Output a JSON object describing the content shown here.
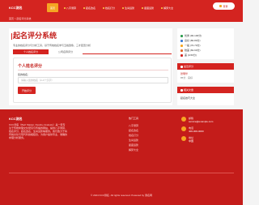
{
  "header": {
    "logo": "KCC测名",
    "nav": [
      {
        "label": "首页",
        "active": true
      },
      {
        "label": "八字测算",
        "active": false
      },
      {
        "label": "起名改名",
        "active": false
      },
      {
        "label": "姓名打分",
        "active": false
      },
      {
        "label": "生肖运势",
        "active": false
      },
      {
        "label": "星座运势",
        "active": false
      },
      {
        "label": "解梦大全",
        "active": false
      }
    ],
    "login_label": "登录",
    "breadcrumb": "首页 > 起名评分系统"
  },
  "main": {
    "title": "起名评分系统",
    "description": "专业的姓名评分与分析工具，基于传统姓名学与五格剖象，三才配置分析",
    "tabs": [
      "个人姓名评分",
      "公司名称评分"
    ],
    "form": {
      "title": "个人姓名评分",
      "label": "您的姓名：",
      "placeholder": "请输入您的姓名（2-4个汉字）",
      "submit_label": "开始评分"
    }
  },
  "sidebar": {
    "legend": [
      {
        "label": "优秀 (90-100分)",
        "color": "#2e9e4f"
      },
      {
        "label": "良好 (80-89分)",
        "color": "#3a7bd5"
      },
      {
        "label": "一般 (70-79分)",
        "color": "#f5a623"
      },
      {
        "label": "较差 (60-69分)",
        "color": "#e06c2c"
      },
      {
        "label": "差 (0-59分)",
        "color": "#d42420"
      }
    ],
    "recent": {
      "title": "最近评分",
      "name": "张明华",
      "score": "85分 · 良好"
    },
    "articles": {
      "title": "相关文章",
      "items": [
        "起名技巧大全"
      ]
    }
  },
  "footer": {
    "logo": "KCC测名",
    "about": "KCC测名（Bazi Master, Destiny Analysis）是一家专注于传统命理文化研究与传播的网站，提供八字测算、姓名评分、起名改名、生肖运势等服务。我们致力于将传统文化与现代科技相结合，为用户提供专业、准确的命理分析服务。",
    "column_title": "热门工具",
    "links": [
      "八字测算",
      "起名改名",
      "姓名打分",
      "生肖运势",
      "星座运势",
      "解梦大全"
    ],
    "contact": [
      {
        "label": "邮箱",
        "value": "service@example.com"
      },
      {
        "label": "电话",
        "value": "400-000-0000"
      },
      {
        "label": "地址",
        "value": "中国"
      }
    ],
    "copyright": "© 2024 KCC测名. All rights reserved. Powered by 测名网"
  }
}
